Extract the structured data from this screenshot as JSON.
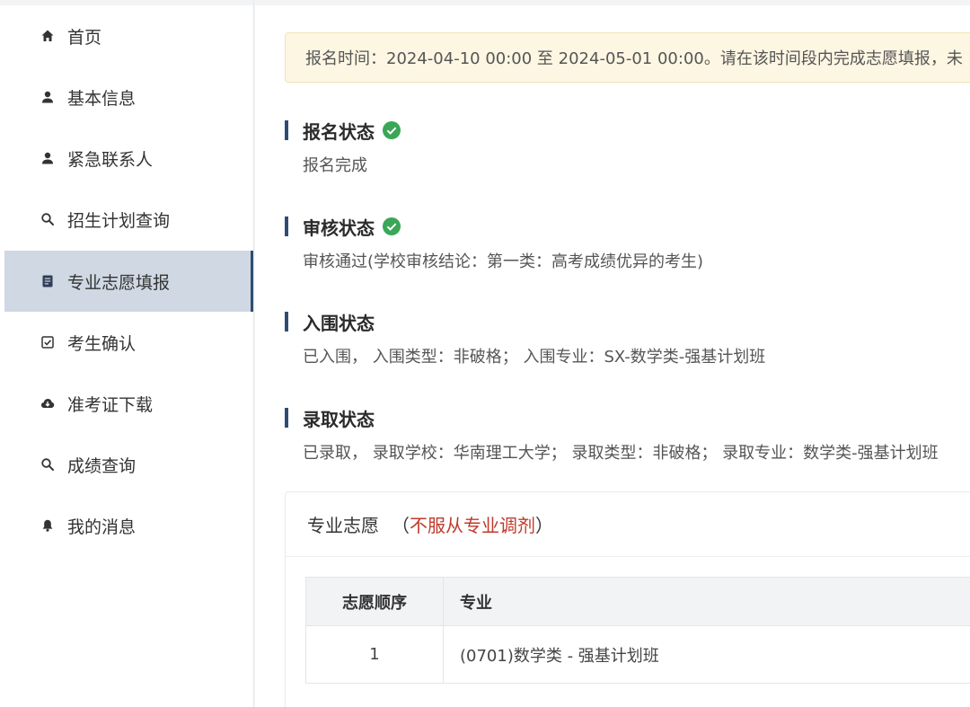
{
  "sidebar": {
    "items": [
      {
        "label": "首页",
        "icon": "home-icon"
      },
      {
        "label": "基本信息",
        "icon": "user-icon"
      },
      {
        "label": "紧急联系人",
        "icon": "user-icon"
      },
      {
        "label": "招生计划查询",
        "icon": "search-icon"
      },
      {
        "label": "专业志愿填报",
        "icon": "document-icon",
        "active": true
      },
      {
        "label": "考生确认",
        "icon": "checkbox-icon"
      },
      {
        "label": "准考证下载",
        "icon": "cloud-download-icon"
      },
      {
        "label": "成绩查询",
        "icon": "search-icon"
      },
      {
        "label": "我的消息",
        "icon": "bell-icon"
      }
    ]
  },
  "notice": {
    "text": "报名时间：2024-04-10 00:00 至 2024-05-01 00:00。请在该时间段内完成志愿填报，未"
  },
  "statuses": [
    {
      "title": "报名状态",
      "checked": true,
      "desc": "报名完成"
    },
    {
      "title": "审核状态",
      "checked": true,
      "desc": "审核通过(学校审核结论：第一类：高考成绩优异的考生)"
    },
    {
      "title": "入围状态",
      "checked": false,
      "desc": "已入围， 入围类型：非破格； 入围专业：SX-数学类-强基计划班"
    },
    {
      "title": "录取状态",
      "checked": false,
      "desc": "已录取， 录取学校：华南理工大学； 录取类型：非破格； 录取专业：数学类-强基计划班"
    }
  ],
  "card": {
    "title": "专业志愿",
    "paren_open": "（",
    "adjust_note": "不服从专业调剂",
    "paren_close": "）",
    "table": {
      "headers": [
        "志愿顺序",
        "专业"
      ],
      "rows": [
        {
          "order": "1",
          "major": "(0701)数学类 - 强基计划班"
        }
      ]
    }
  },
  "colors": {
    "accent": "#2f4d73",
    "active_bg": "#cfd8e3",
    "success": "#3aa757",
    "warning_text": "#c0392b",
    "notice_bg": "#fdf6e3"
  }
}
